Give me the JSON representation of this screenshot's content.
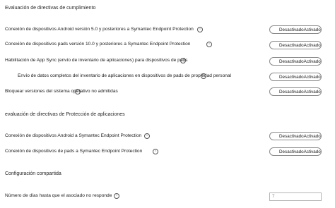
{
  "sections": {
    "compliance_title": "Evaluación de directivas de cumplimiento",
    "app_protection_title": "evaluación de directivas de Protección de aplicaciones",
    "shared_config_title": "Configuración compartida"
  },
  "compliance_rows": [
    {
      "label": "Conexión de dispositivos Android versión 5.0 y posteriores a Symantec Endpoint Protection",
      "off": "Desactivado",
      "on": "Activado"
    },
    {
      "label": "Conexión de dispositivos pads versión 10.0 y posteriores a Symantec Endpoint Protection",
      "off": "Desactivado",
      "on": "Activado"
    },
    {
      "label": "Habilitación de App Sync (envío de inventario de aplicaciones) para dispositivos de pads",
      "off": "Desactivado",
      "on": "Activado"
    },
    {
      "label": "Envío de datos completos del inventario de aplicaciones en dispositivos de pads de propiedad personal",
      "off": "Desactivado",
      "on": "Activado"
    },
    {
      "label": "Bloquear versiones del sistema operativo no admitidas",
      "off": "Desactivado",
      "on": "Activado"
    }
  ],
  "app_protection_rows": [
    {
      "label": "Conexión de dispositivos Android a Symantec Endpoint Protection",
      "off": "Desactivado",
      "on": "Activado"
    },
    {
      "label": "Conexión de dispositivos de pads a Symantec Endpoint Protection",
      "off": "Desactivado",
      "on": "Activado"
    }
  ],
  "shared": {
    "days_label": "Número de días hasta que el asociado no responde",
    "days_value": "7"
  },
  "icons": {
    "info_glyph": "i"
  }
}
